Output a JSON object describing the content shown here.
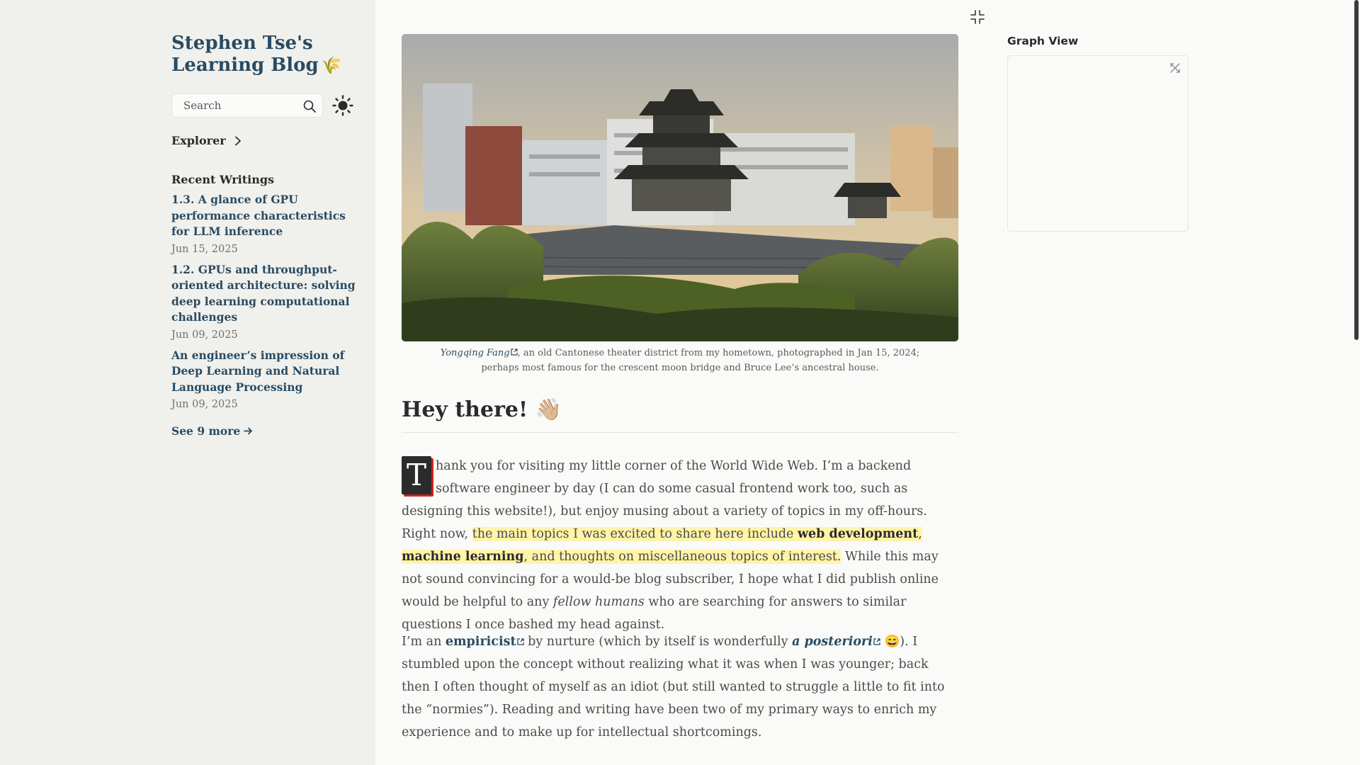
{
  "site": {
    "title": "Stephen Tse's Learning Blog",
    "title_emoji": "🌾"
  },
  "search": {
    "placeholder": "Search"
  },
  "explorer": {
    "label": "Explorer"
  },
  "recent": {
    "heading": "Recent Writings",
    "items": [
      {
        "title": "1.3. A glance of GPU performance characteristics for LLM inference",
        "date": "Jun 15, 2025"
      },
      {
        "title": "1.2. GPUs and throughput-oriented architecture: solving deep learning computational challenges",
        "date": "Jun 09, 2025"
      },
      {
        "title": "An engineer’s impression of Deep Learning and Natural Language Processing",
        "date": "Jun 09, 2025"
      }
    ],
    "see_more": "See 9 more"
  },
  "hero": {
    "caption_link": "Yongqing Fang",
    "caption_line1": ", an old Cantonese theater district from my hometown, photographed in Jan 15, 2024;",
    "caption_line2": "perhaps most famous for the crescent moon bridge and Bruce Lee’s ancestral house."
  },
  "article": {
    "heading": "Hey there!",
    "heading_emoji": "👋🏼",
    "p1": {
      "dropcap": "T",
      "t1": "hank you for visiting my little corner of the World Wide Web. I’m a backend software engineer by day (I can do some casual frontend work too, such as designing this website!), but enjoy musing about a variety of topics in my off-hours. Right now, ",
      "hl1": "the main topics I was excited to share here include ",
      "b1": "web development",
      "hl2": ", ",
      "b2": "machine learning",
      "hl3": ", and thoughts on miscellaneous topics of interest.",
      "t2": " While this may not sound convincing for a would-be blog subscriber, I hope what I did publish online would be helpful to any ",
      "em1": "fellow humans",
      "t3": " who are searching for answers to similar questions I once bashed my head against."
    },
    "p2": {
      "t1": "I’m an ",
      "link1": "empiricist",
      "t2": " by nurture (which by itself is wonderfully ",
      "link2": "a posteriori",
      "emoji": "😄",
      "t3": "). I stumbled upon the concept without realizing what it was when I was younger; back then I often thought of myself as an idiot (but still wanted to struggle a little to fit into the “normies”). Reading and writing have been two of my primary ways to enrich my experience and to make up for intellectual shortcomings."
    }
  },
  "graph": {
    "title": "Graph View"
  },
  "colors": {
    "accent": "#284b63",
    "highlight": "#fff4a8",
    "sidebar_bg": "#f0f0ec",
    "page_bg": "#fafaf8",
    "dropcap_shadow": "#c9251d"
  },
  "icons": {
    "search": "search-icon",
    "theme": "sun-icon",
    "explorer": "chevron-right-icon",
    "see_more": "arrow-right-icon",
    "collapse": "collapse-icon",
    "graph_expand": "expand-icon",
    "external_link": "external-link-icon"
  }
}
